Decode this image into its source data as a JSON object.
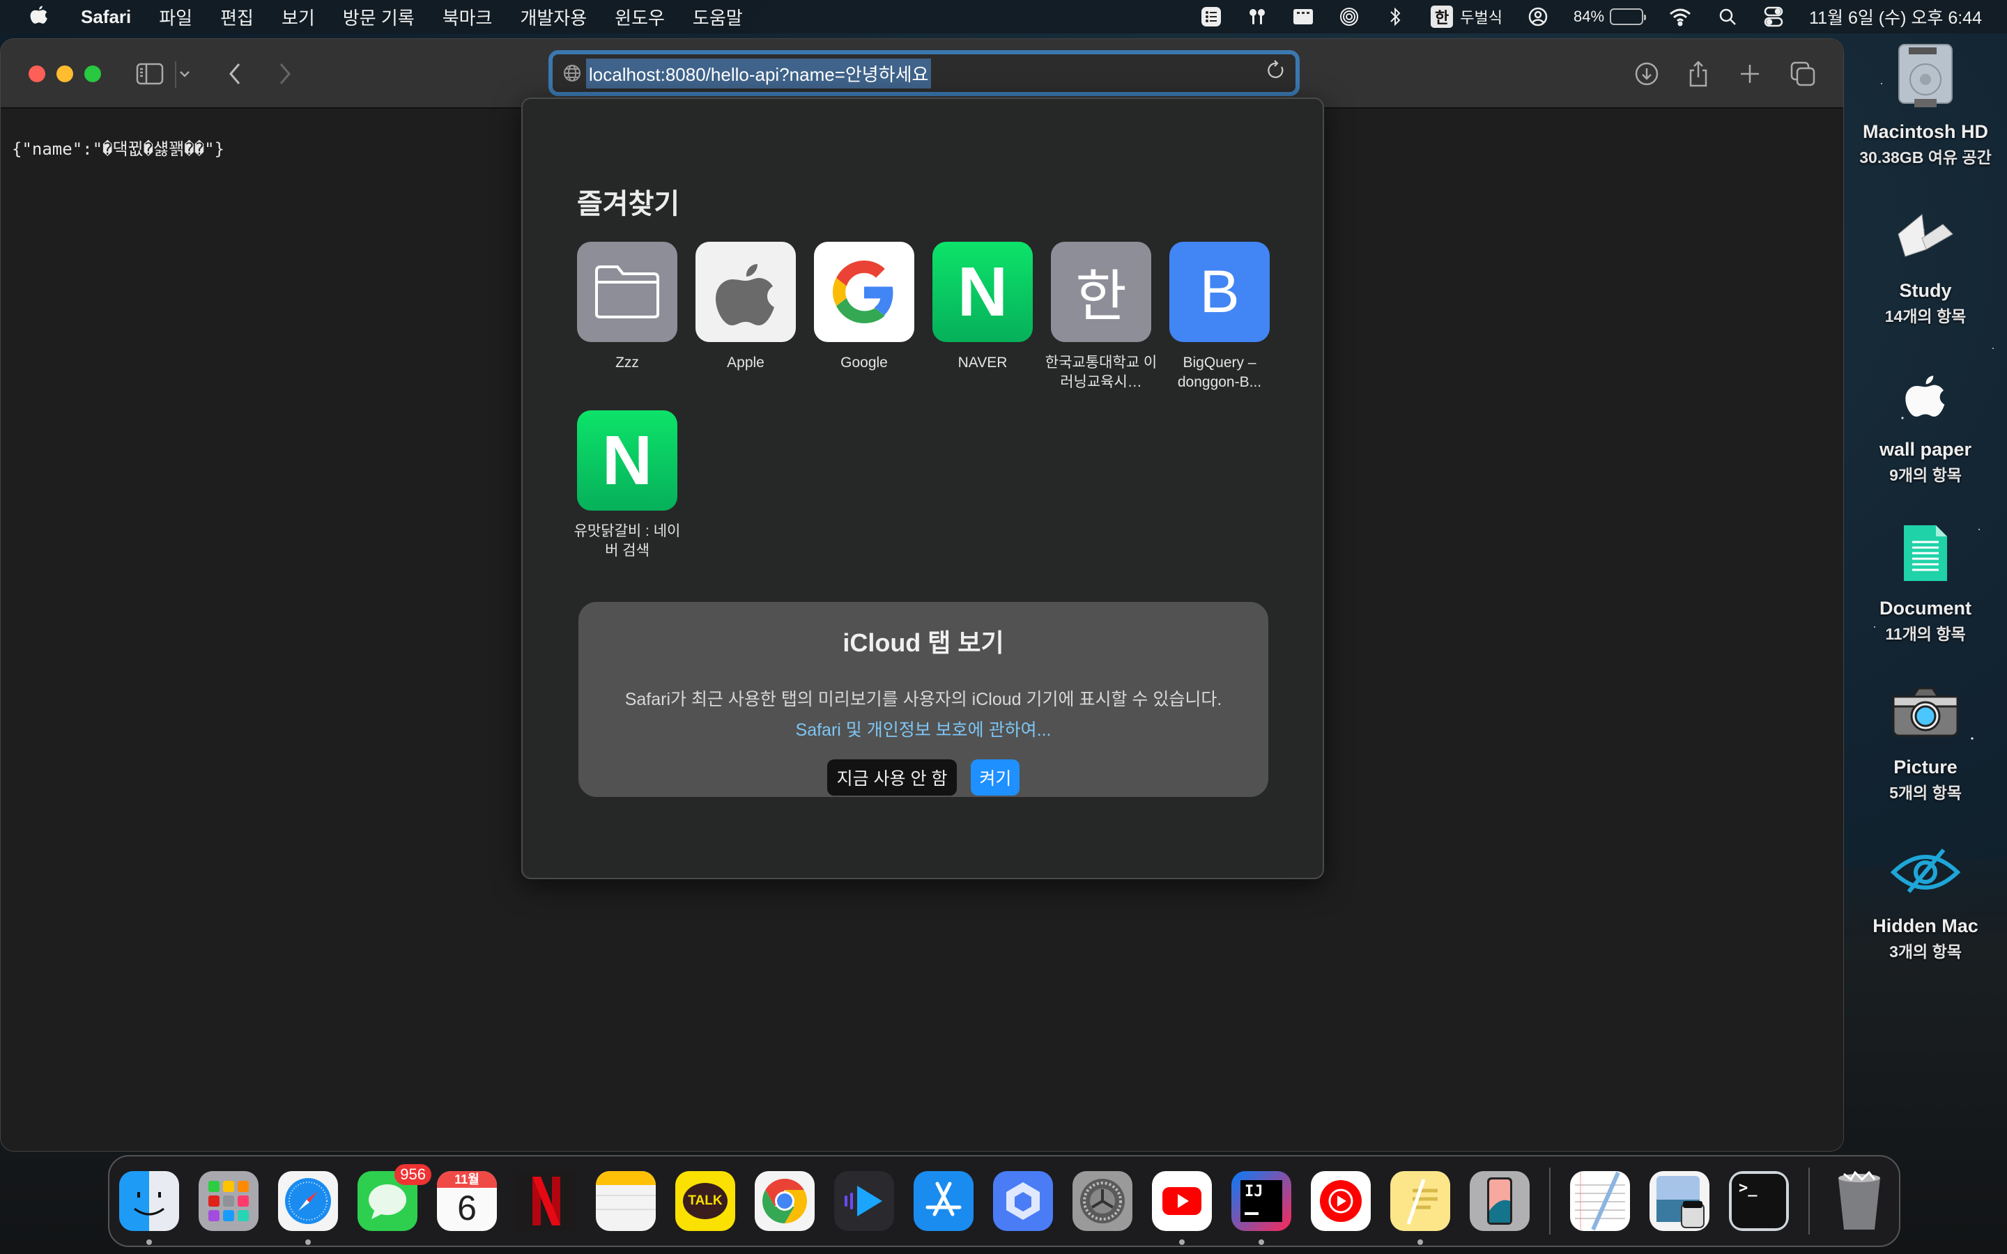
{
  "menubar": {
    "app_name": "Safari",
    "menus": [
      "파일",
      "편집",
      "보기",
      "방문 기록",
      "북마크",
      "개발자용",
      "윈도우",
      "도움말"
    ],
    "input_method_badge": "한",
    "input_method_name": "두벌식",
    "battery_percent": "84%",
    "battery_level": 0.84,
    "clock": "11월 6일 (수) 오후 6:44"
  },
  "browser": {
    "url": "localhost:8080/hello-api?name=안녕하세요",
    "page_text": "{\"name\":\"�댁뀞�섏꽭��\"}"
  },
  "favorites": {
    "title": "즐겨찾기",
    "items": [
      {
        "label": "Zzz",
        "icon": "folder-icon"
      },
      {
        "label": "Apple",
        "icon": "apple-logo-icon"
      },
      {
        "label": "Google",
        "icon": "google-logo-icon"
      },
      {
        "label": "NAVER",
        "icon": "naver-logo-icon",
        "glyph": "N"
      },
      {
        "label": "한국교통대학교 이러닝교육시…",
        "icon": "han-letter-icon",
        "glyph": "한"
      },
      {
        "label": "BigQuery – donggon-B...",
        "icon": "letter-b-icon",
        "glyph": "B"
      },
      {
        "label": "유맛닭갈비 : 네이버 검색",
        "icon": "naver-logo-icon",
        "glyph": "N"
      }
    ]
  },
  "icloud": {
    "title": "iCloud 탭 보기",
    "description": "Safari가 최근 사용한 탭의 미리보기를 사용자의 iCloud 기기에 표시할 수 있습니다.",
    "link": "Safari 및 개인정보 보호에 관하여...",
    "btn_not_now": "지금 사용 안 함",
    "btn_turn_on": "켜기"
  },
  "desktop": [
    {
      "name": "Macintosh HD",
      "count": "30.38GB 여유 공간"
    },
    {
      "name": "Study",
      "count": "14개의 항목"
    },
    {
      "name": "wall paper",
      "count": "9개의 항목"
    },
    {
      "name": "Document",
      "count": "11개의 항목"
    },
    {
      "name": "Picture",
      "count": "5개의 항목"
    },
    {
      "name": "Hidden Mac",
      "count": "3개의 항목"
    }
  ],
  "dock": {
    "messages_badge": "956",
    "calendar_month": "11월",
    "calendar_day": "6",
    "kakao_label": "TALK",
    "intellij_label": "IJ",
    "apps": [
      "Finder",
      "Launchpad",
      "Safari",
      "Messages",
      "Calendar",
      "Netflix",
      "Notes",
      "KakaoTalk",
      "Chrome",
      "Infuse",
      "App Store",
      "Toolbox",
      "System Settings",
      "YouTube",
      "IntelliJ IDEA",
      "YouTube Music",
      "Stickies",
      "iPhone Mirroring",
      "TextEdit",
      "Preview",
      "Terminal",
      "Trash"
    ]
  }
}
